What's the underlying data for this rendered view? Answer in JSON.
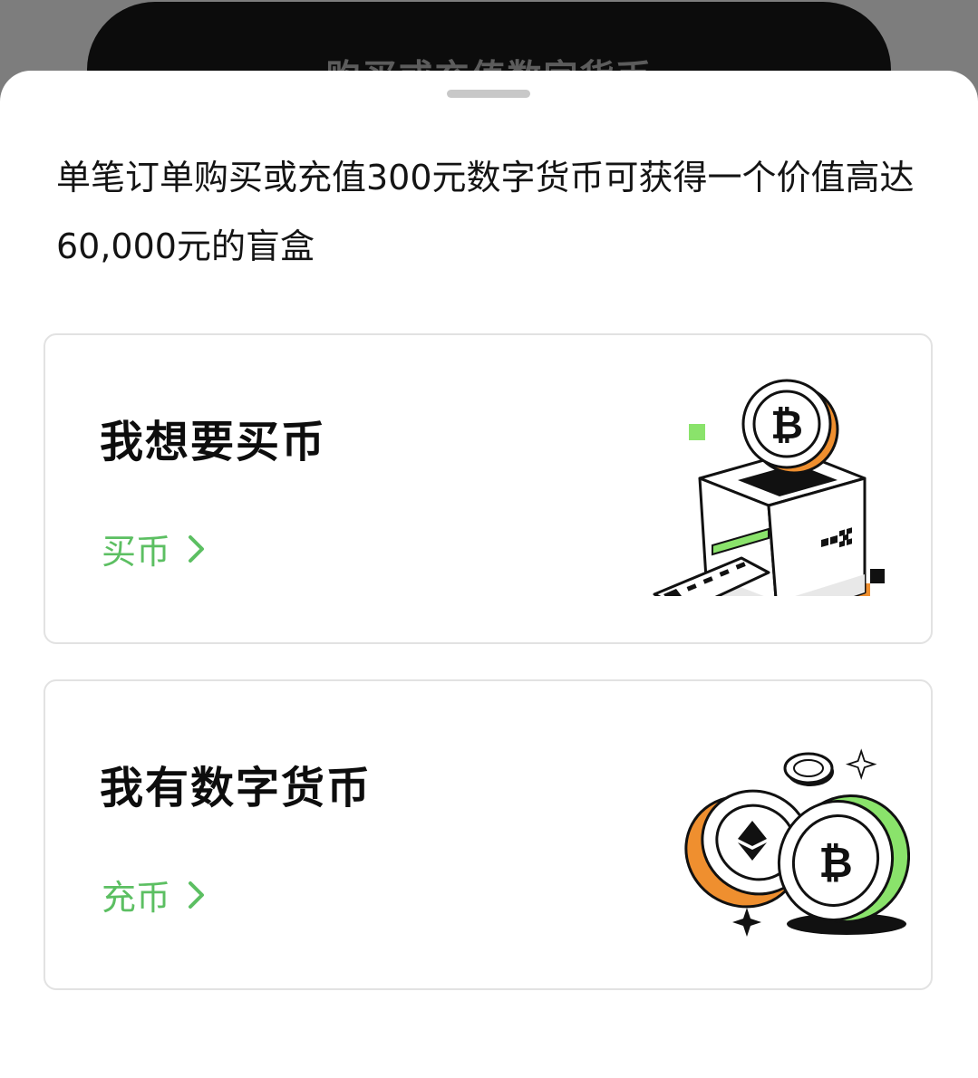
{
  "background": {
    "button_label": "购买或充值数字货币"
  },
  "sheet": {
    "promo_text": "单笔订单购买或充值300元数字货币可获得一个价值高达60,000元的盲盒"
  },
  "cards": [
    {
      "title": "我想要买币",
      "link_label": "买币",
      "illustration": "bitcoin-card-machine"
    },
    {
      "title": "我有数字货币",
      "link_label": "充币",
      "illustration": "crypto-coins"
    }
  ],
  "colors": {
    "accent_green": "#5cbf62",
    "orange": "#ef8f2f",
    "lime": "#8ae36b",
    "text": "#141414"
  },
  "machine_brand": "OKX"
}
